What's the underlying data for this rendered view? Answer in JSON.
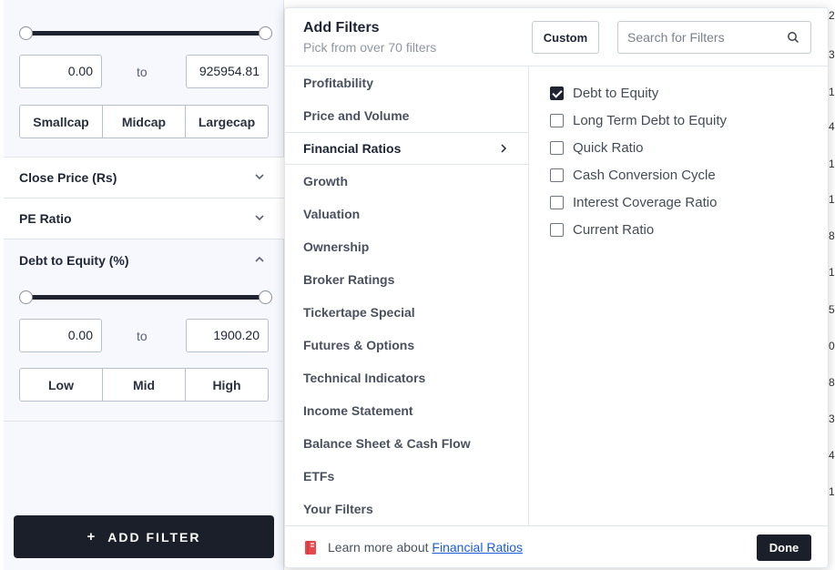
{
  "sidebar": {
    "market_cap": {
      "min_value": "0.00",
      "to_label": "to",
      "max_value": "925954.81",
      "presets": [
        "Smallcap",
        "Midcap",
        "Largecap"
      ]
    },
    "close_price": {
      "title": "Close Price (Rs)"
    },
    "pe_ratio": {
      "title": "PE Ratio"
    },
    "debt_to_equity": {
      "title": "Debt to Equity (%)",
      "min_value": "0.00",
      "to_label": "to",
      "max_value": "1900.20",
      "presets": [
        "Low",
        "Mid",
        "High"
      ]
    },
    "add_filter_label": "ADD FILTER",
    "add_filter_plus": "+"
  },
  "background_digits": [
    "2",
    "3",
    "1",
    "4",
    "1",
    "1",
    "8",
    "1",
    "5",
    "0",
    "8",
    "3",
    "4",
    "1"
  ],
  "modal": {
    "title": "Add Filters",
    "subtitle": "Pick from over 70 filters",
    "custom_label": "Custom",
    "search_placeholder": "Search for Filters",
    "categories": [
      "Profitability",
      "Price and Volume",
      "Financial Ratios",
      "Growth",
      "Valuation",
      "Ownership",
      "Broker Ratings",
      "Tickertape Special",
      "Futures & Options",
      "Technical Indicators",
      "Income Statement",
      "Balance Sheet & Cash Flow",
      "ETFs",
      "Your Filters"
    ],
    "active_category": "Financial Ratios",
    "options": [
      {
        "label": "Debt to Equity",
        "checked": true
      },
      {
        "label": "Long Term Debt to Equity",
        "checked": false
      },
      {
        "label": "Quick Ratio",
        "checked": false
      },
      {
        "label": "Cash Conversion Cycle",
        "checked": false
      },
      {
        "label": "Interest Coverage Ratio",
        "checked": false
      },
      {
        "label": "Current Ratio",
        "checked": false
      }
    ],
    "footer": {
      "learn_text": "Learn more about",
      "learn_link": "Financial Ratios",
      "done_label": "Done"
    }
  },
  "colors": {
    "primary_dark": "#1a1f29",
    "link": "#1a5cd6",
    "sidebar_bg": "#f6f8fd",
    "book_icon": "#e8474b"
  }
}
